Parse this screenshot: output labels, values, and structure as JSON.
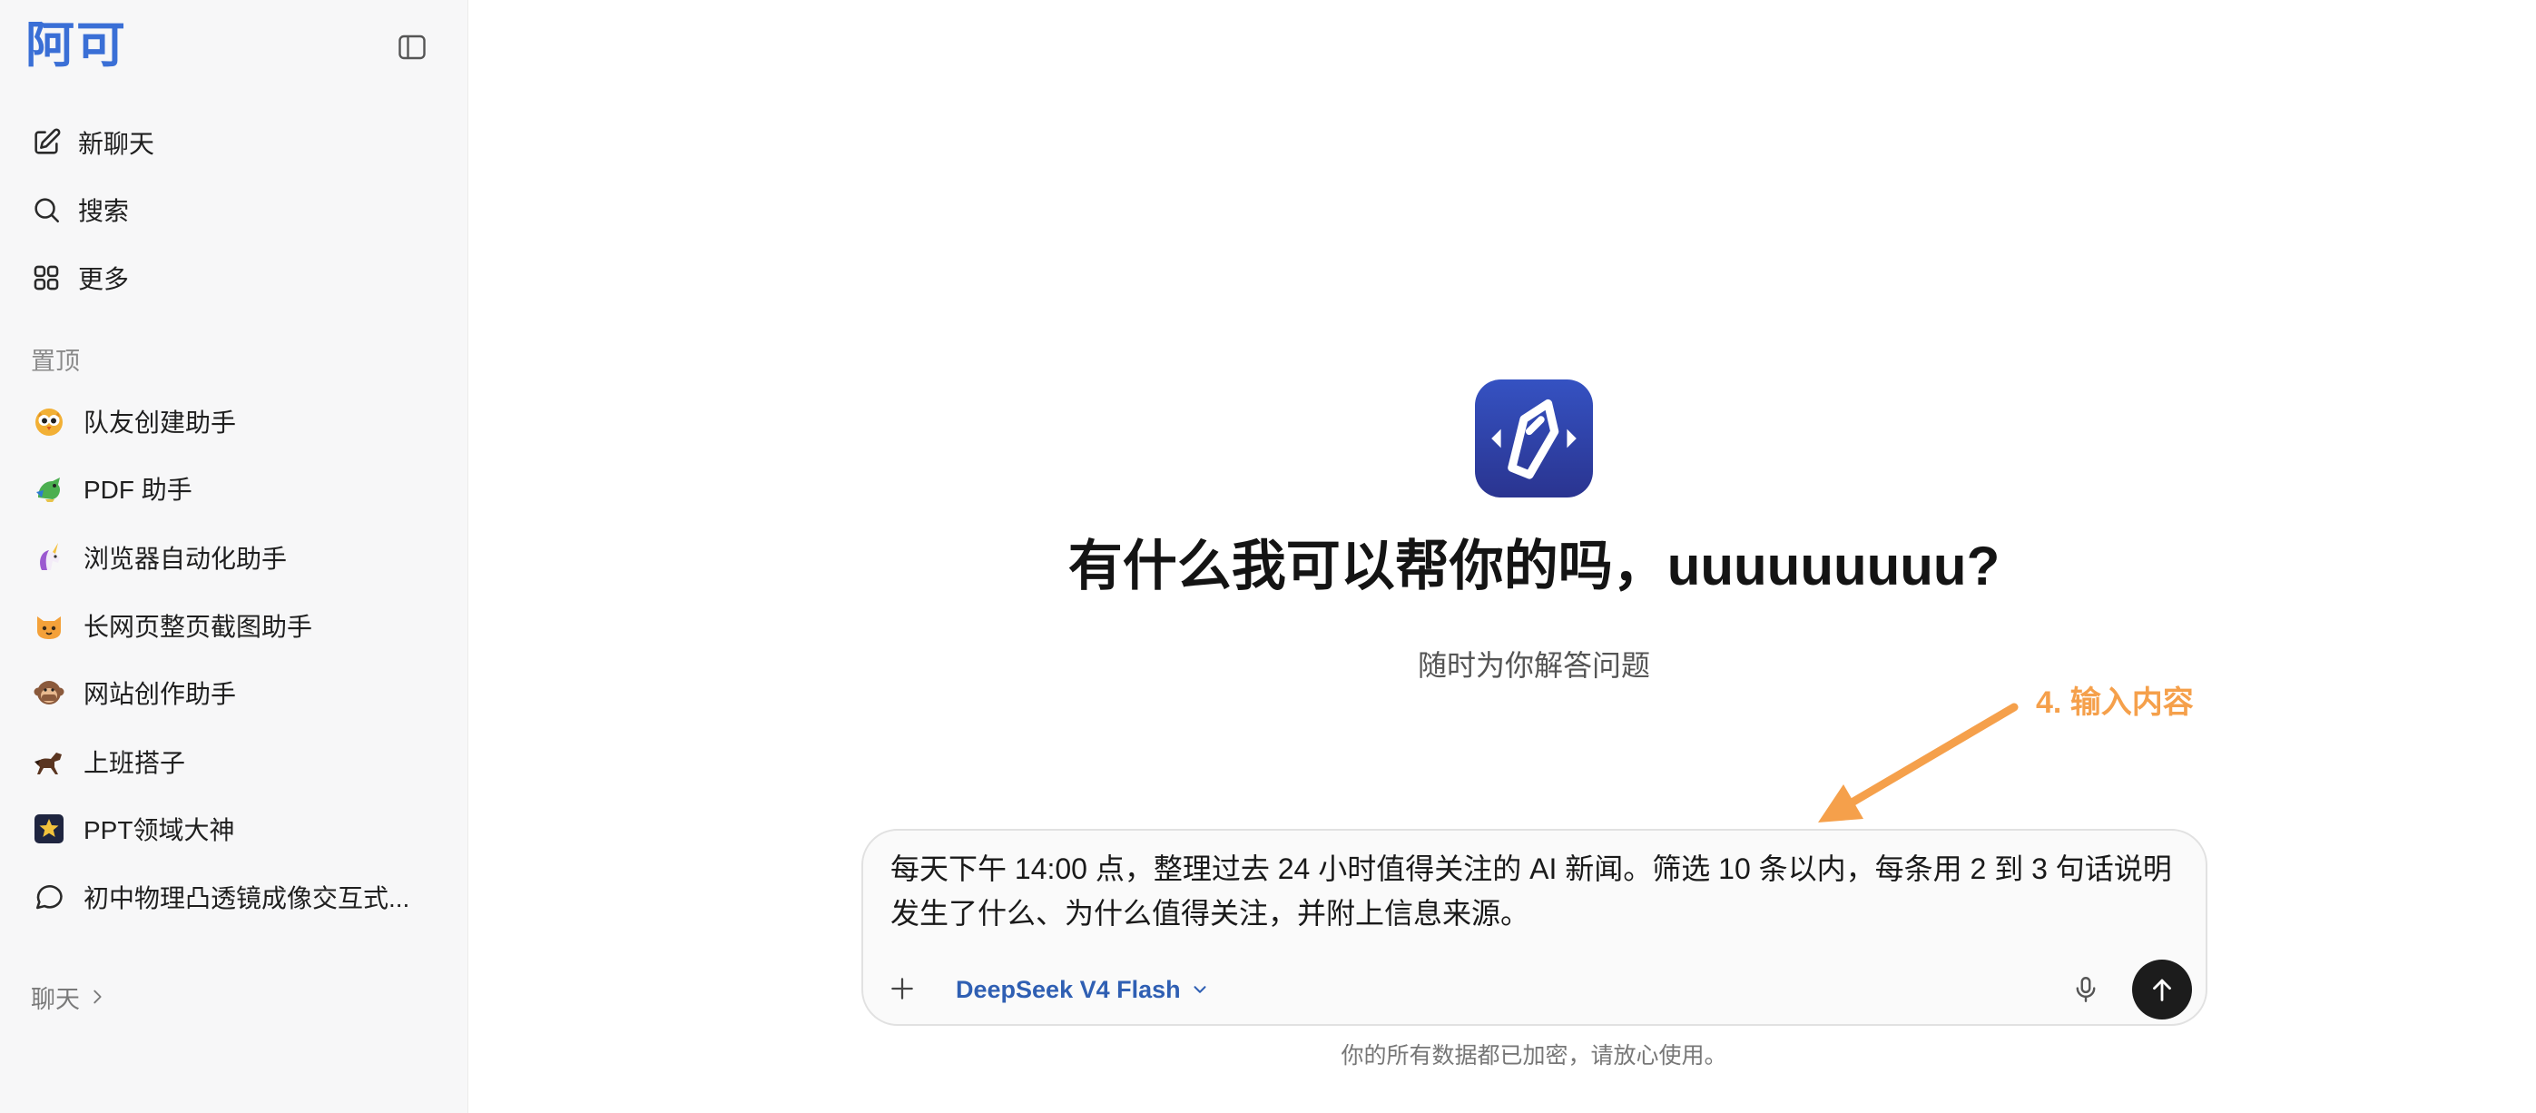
{
  "app": {
    "logo_text": "阿可",
    "logo_icon": "brand-logo"
  },
  "sidebar": {
    "toggle_icon": "sidebar-toggle-icon",
    "nav": [
      {
        "label": "新聊天",
        "icon": "edit-icon"
      },
      {
        "label": "搜索",
        "icon": "search-icon"
      },
      {
        "label": "更多",
        "icon": "grid-icon"
      }
    ],
    "pinned_title": "置顶",
    "pinned": [
      {
        "label": "队友创建助手",
        "icon": "chick-emoji-icon"
      },
      {
        "label": "PDF 助手",
        "icon": "dragon-emoji-icon"
      },
      {
        "label": "浏览器自动化助手",
        "icon": "unicorn-emoji-icon"
      },
      {
        "label": "长网页整页截图助手",
        "icon": "cat-emoji-icon"
      },
      {
        "label": "网站创作助手",
        "icon": "monkey-emoji-icon"
      },
      {
        "label": "上班搭子",
        "icon": "horse-emoji-icon"
      },
      {
        "label": "PPT领域大神",
        "icon": "star-image-icon"
      },
      {
        "label": "初中物理凸透镜成像交互式...",
        "icon": "chat-bubble-icon"
      }
    ],
    "chats_title": "聊天",
    "chats_chevron_icon": "chevron-right-icon"
  },
  "main": {
    "assistant_icon": "app-logo-icon",
    "greeting": "有什么我可以帮你的吗，uuuuuuuuu?",
    "subtitle": "随时为你解答问题",
    "composer": {
      "value": "每天下午 14:00 点，整理过去 24 小时值得关注的 AI 新闻。筛选 10 条以内，每条用 2 到 3 句话说明发生了什么、为什么值得关注，并附上信息来源。",
      "attach_icon": "plus-icon",
      "model": "DeepSeek V4 Flash",
      "model_dropdown_icon": "chevron-down-icon",
      "voice_icon": "microphone-icon",
      "send_icon": "arrow-up-icon"
    },
    "disclaimer": "你的所有数据都已加密，请放心使用。"
  },
  "annotation": {
    "label": "4. 输入内容",
    "arrow_icon": "annotation-arrow-icon"
  },
  "colors": {
    "brand_blue": "#3a6fd6",
    "model_blue": "#2f5fb3",
    "annotation_orange": "#f5a04b",
    "send_button": "#1c1c1c",
    "sidebar_bg": "#f7f7f8"
  }
}
